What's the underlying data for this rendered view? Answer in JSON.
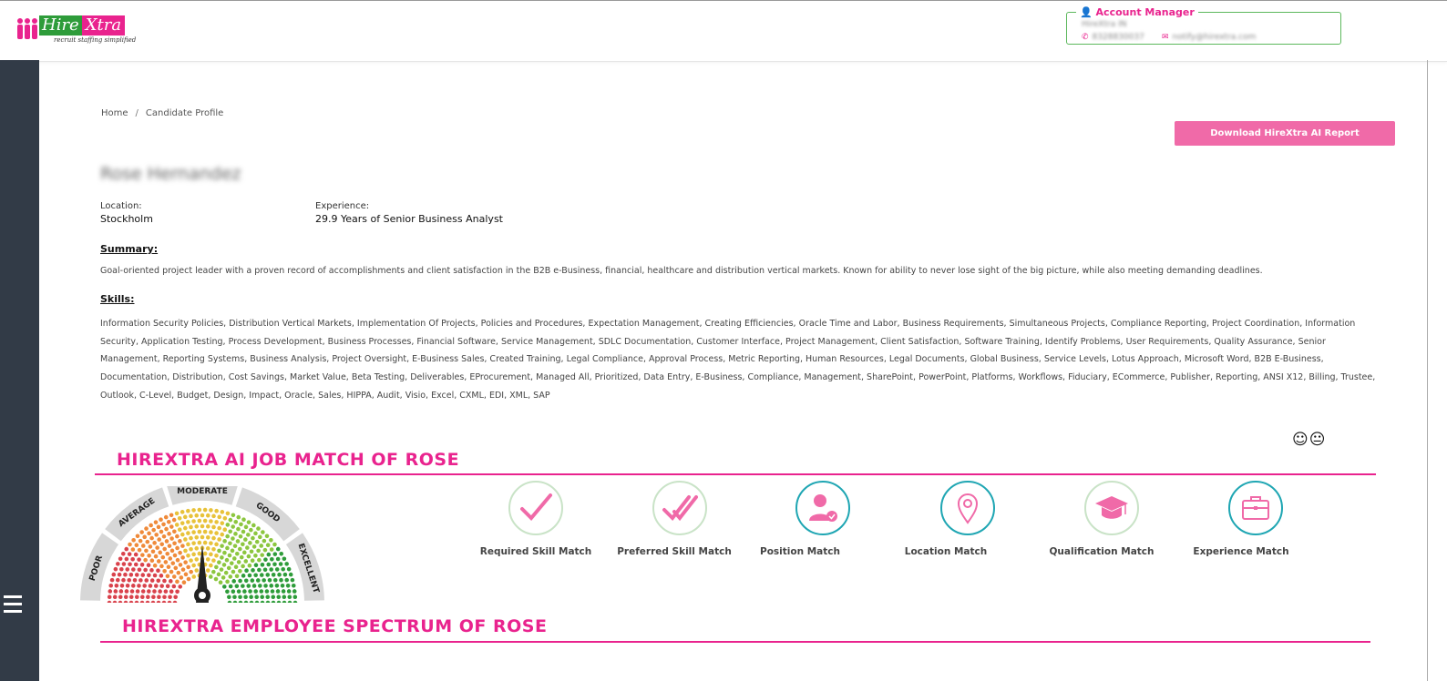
{
  "header": {
    "logo": {
      "brand_left": "Hire",
      "brand_right": "Xtra",
      "tagline": "recruit staffing simplified"
    },
    "account_manager": {
      "title": "Account Manager",
      "name": "HireXtra IN",
      "phone": "8328830037",
      "email": "notify@hirextra.com"
    }
  },
  "breadcrumb": {
    "home": "Home",
    "separator": "/",
    "current": "Candidate Profile"
  },
  "download_button": "Download HireXtra AI Report",
  "candidate": {
    "name": "Rose Hernandez",
    "location_label": "Location:",
    "location": "Stockholm",
    "experience_label": "Experience:",
    "experience": "29.9 Years of Senior Business Analyst",
    "summary_label": "Summary:",
    "summary": "Goal-oriented project leader with a proven record of accomplishments and client satisfaction in the B2B e-Business, financial, healthcare and distribution vertical markets. Known for ability to never lose sight of the big picture, while also meeting demanding deadlines.",
    "skills_label": "Skills:",
    "skills": "Information Security Policies, Distribution Vertical Markets, Implementation Of Projects, Policies and Procedures, Expectation Management, Creating Efficiencies, Oracle Time and Labor, Business Requirements, Simultaneous Projects, Compliance Reporting, Project Coordination, Information Security, Application Testing, Process Development, Business Processes, Financial Software, Service Management, SDLC Documentation, Customer Interface, Project Management, Client Satisfaction, Software Training, Identify Problems, User Requirements, Quality Assurance, Senior Management, Reporting Systems, Business Analysis, Project Oversight, E-Business Sales, Created Training, Legal Compliance, Approval Process, Metric Reporting, Human Resources, Legal Documents, Global Business, Service Levels, Lotus Approach, Microsoft Word, B2B E-Business, Documentation, Distribution, Cost Savings, Market Value, Beta Testing, Deliverables, EProcurement, Managed All, Prioritized, Data Entry, E-Business, Compliance, Management, SharePoint, PowerPoint, Platforms, Workflows, Fiduciary, ECommerce, Publisher, Reporting, ANSI X12, Billing, Trustee, Outlook, C-Level, Budget, Design, Impact, Oracle, Sales, HIPPA, Audit, Visio, Excel, CXML, EDI, XML, SAP"
  },
  "emoticons": "☺😐",
  "job_match": {
    "title": "HIREXTRA AI JOB MATCH OF ROSE",
    "gauge": {
      "segments": [
        "POOR",
        "AVERAGE",
        "MODERATE",
        "GOOD",
        "EXCELLENT"
      ],
      "needle_level": 0.5
    },
    "metrics": [
      {
        "label": "Required Skill Match",
        "icon": "check-icon"
      },
      {
        "label": "Preferred Skill Match",
        "icon": "double-check-icon"
      },
      {
        "label": "Position Match",
        "icon": "user-check-icon"
      },
      {
        "label": "Location Match",
        "icon": "map-pin-icon"
      },
      {
        "label": "Qualification Match",
        "icon": "graduation-cap-icon"
      },
      {
        "label": "Experience Match",
        "icon": "briefcase-icon"
      }
    ]
  },
  "spectrum": {
    "title": "HIREXTRA EMPLOYEE SPECTRUM OF ROSE"
  },
  "colors": {
    "accent": "#e9238e",
    "button": "#f06aa8",
    "sidebar": "#323b47",
    "teal": "#1fa6b3"
  }
}
